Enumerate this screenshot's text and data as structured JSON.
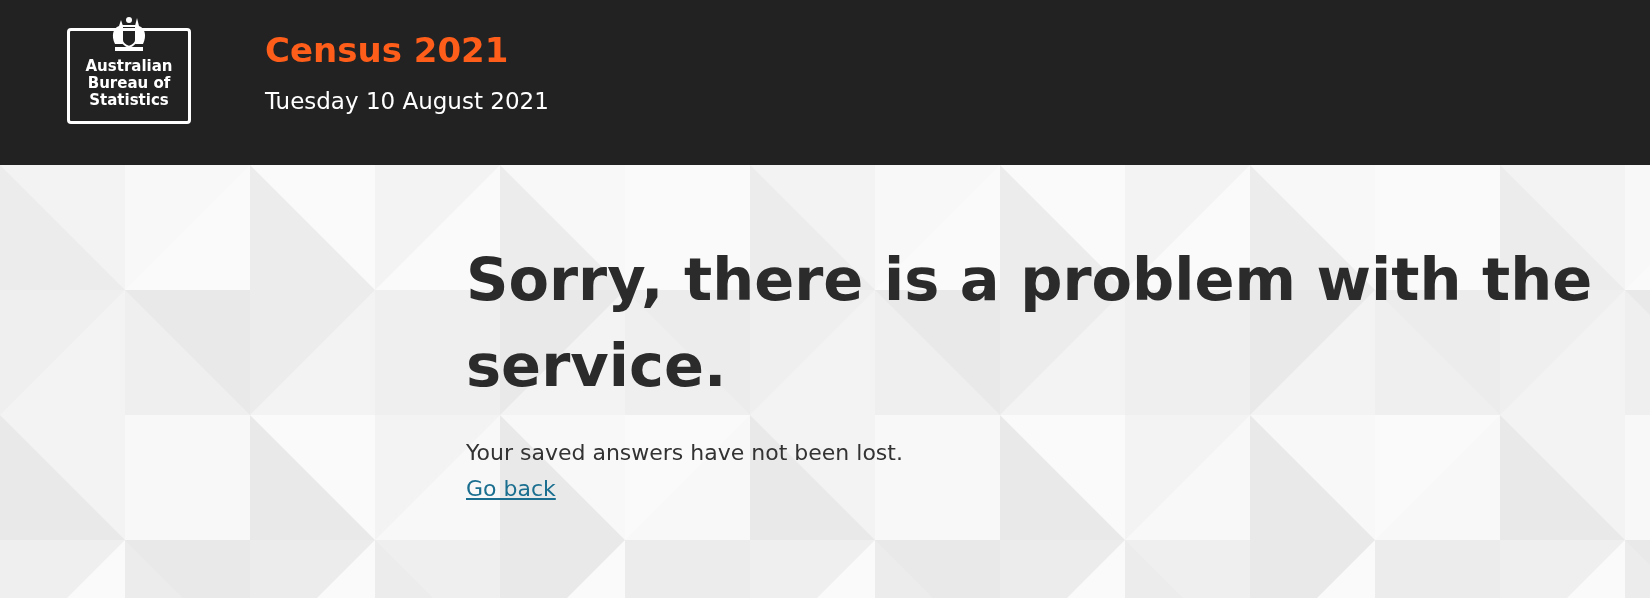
{
  "header": {
    "logo_text": "Australian Bureau of Statistics",
    "title": "Census 2021",
    "date": "Tuesday 10 August 2021"
  },
  "error": {
    "heading": "Sorry, there is a problem with the service.",
    "message": "Your saved answers have not been lost.",
    "link": "Go back"
  }
}
